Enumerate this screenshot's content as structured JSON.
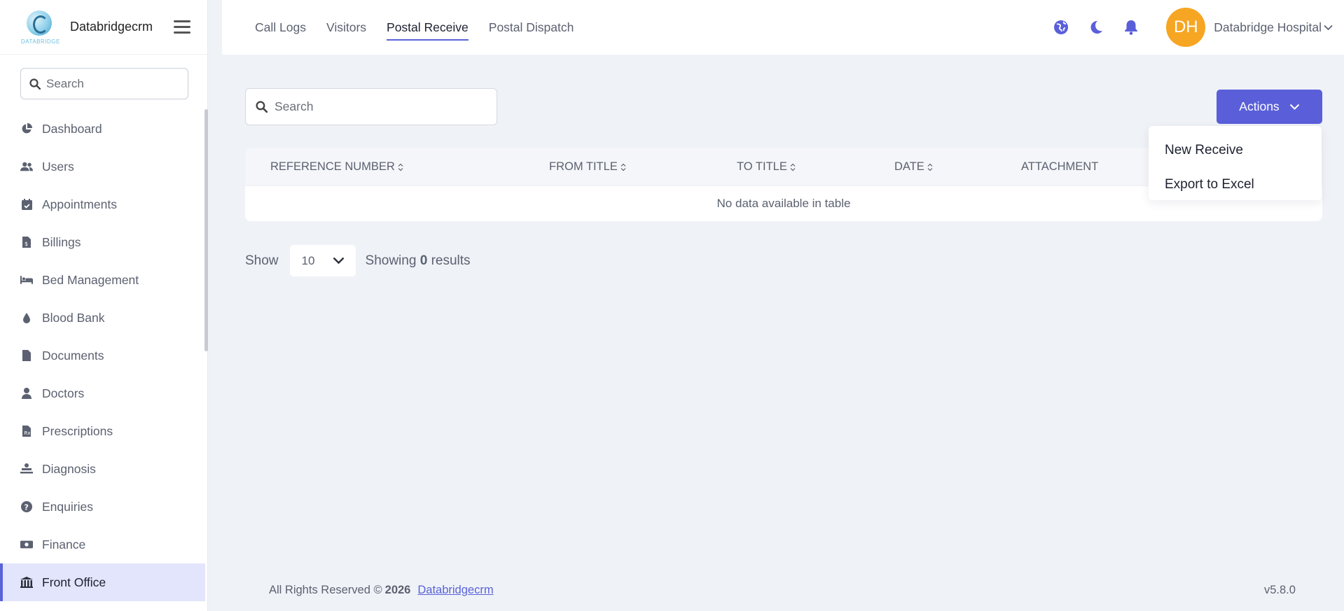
{
  "brand": {
    "name": "Databridgecrm",
    "logo_text": "DATABRIDGE"
  },
  "sidebar": {
    "search_placeholder": "Search",
    "items": [
      {
        "label": "Dashboard",
        "icon": "pie-chart-icon"
      },
      {
        "label": "Users",
        "icon": "users-icon"
      },
      {
        "label": "Appointments",
        "icon": "calendar-check-icon"
      },
      {
        "label": "Billings",
        "icon": "invoice-icon"
      },
      {
        "label": "Bed Management",
        "icon": "bed-icon"
      },
      {
        "label": "Blood Bank",
        "icon": "drop-icon"
      },
      {
        "label": "Documents",
        "icon": "file-icon"
      },
      {
        "label": "Doctors",
        "icon": "doctor-icon"
      },
      {
        "label": "Prescriptions",
        "icon": "prescription-icon"
      },
      {
        "label": "Diagnosis",
        "icon": "diagnosis-icon"
      },
      {
        "label": "Enquiries",
        "icon": "question-icon"
      },
      {
        "label": "Finance",
        "icon": "money-icon"
      },
      {
        "label": "Front Office",
        "icon": "building-icon",
        "active": true
      }
    ]
  },
  "header": {
    "tabs": [
      {
        "label": "Call Logs"
      },
      {
        "label": "Visitors"
      },
      {
        "label": "Postal Receive",
        "active": true
      },
      {
        "label": "Postal Dispatch"
      }
    ],
    "icons": [
      "globe-icon",
      "moon-icon",
      "bell-icon"
    ],
    "avatar_initials": "DH",
    "user_name": "Databridge Hospital"
  },
  "content": {
    "search_placeholder": "Search",
    "actions_label": "Actions",
    "actions_menu": [
      "New Receive",
      "Export to Excel"
    ],
    "table": {
      "columns": [
        "REFERENCE NUMBER",
        "FROM TITLE",
        "TO TITLE",
        "DATE",
        "ATTACHMENT"
      ],
      "empty_message": "No data available in table"
    },
    "pagination": {
      "show_label": "Show",
      "page_size": "10",
      "results_prefix": "Showing",
      "results_count": "0",
      "results_suffix": "results"
    }
  },
  "footer": {
    "rights": "All Rights Reserved ©",
    "year": "2026",
    "link": "Databridgecrm",
    "version": "v5.8.0"
  },
  "colors": {
    "accent": "#5a5fd9",
    "avatar_bg": "#f6a623",
    "active_bg": "#e2e5fb",
    "page_bg": "#eff2f7"
  }
}
